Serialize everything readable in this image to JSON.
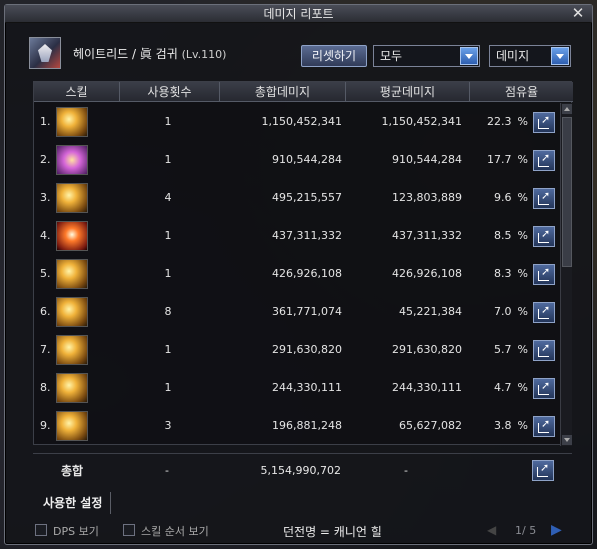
{
  "window": {
    "title": "데미지 리포트"
  },
  "header": {
    "character": "헤이트리드 / 眞 검귀",
    "level": "(Lv.110)",
    "reset_label": "리셋하기",
    "mode_value": "모두",
    "type_value": "데미지"
  },
  "table": {
    "headers": [
      "스킬",
      "사용횟수",
      "총합데미지",
      "평균데미지",
      "점유율"
    ],
    "rows": [
      {
        "rank": "1.",
        "icon": "gold-slash-skill-icon",
        "uses": "1",
        "total": "1,150,452,341",
        "avg": "1,150,452,341",
        "share": "22.3",
        "pct": "%"
      },
      {
        "rank": "2.",
        "icon": "purple-burst-skill-icon",
        "uses": "1",
        "total": "910,544,284",
        "avg": "910,544,284",
        "share": "17.7",
        "pct": "%"
      },
      {
        "rank": "3.",
        "icon": "gold-wave-skill-icon",
        "uses": "4",
        "total": "495,215,557",
        "avg": "123,803,889",
        "share": "9.6",
        "pct": "%"
      },
      {
        "rank": "4.",
        "icon": "red-explosion-skill-icon",
        "uses": "1",
        "total": "437,311,332",
        "avg": "437,311,332",
        "share": "8.5",
        "pct": "%"
      },
      {
        "rank": "5.",
        "icon": "gold-arc-skill-icon",
        "uses": "1",
        "total": "426,926,108",
        "avg": "426,926,108",
        "share": "8.3",
        "pct": "%"
      },
      {
        "rank": "6.",
        "icon": "gold-streak-skill-icon",
        "uses": "8",
        "total": "361,771,074",
        "avg": "45,221,384",
        "share": "7.0",
        "pct": "%"
      },
      {
        "rank": "7.",
        "icon": "gold-spin-skill-icon",
        "uses": "1",
        "total": "291,630,820",
        "avg": "291,630,820",
        "share": "5.7",
        "pct": "%"
      },
      {
        "rank": "8.",
        "icon": "gold-rush-skill-icon",
        "uses": "1",
        "total": "244,330,111",
        "avg": "244,330,111",
        "share": "4.7",
        "pct": "%"
      },
      {
        "rank": "9.",
        "icon": "gold-crescent-skill-icon",
        "uses": "3",
        "total": "196,881,248",
        "avg": "65,627,082",
        "share": "3.8",
        "pct": "%"
      }
    ]
  },
  "totals": {
    "label": "총합",
    "uses": "-",
    "total": "5,154,990,702",
    "avg": "-"
  },
  "tabs": {
    "used_settings": "사용한 설정"
  },
  "footer": {
    "dps_label": "DPS 보기",
    "skill_order_label": "스킬 순서 보기",
    "dungeon": "던전명 = 캐니언 힐",
    "page": "1/ 5"
  },
  "colors": {
    "accent_blue": "#2e5fb0",
    "panel_bg": "#14151a",
    "gold_icon": "#f0b23a"
  }
}
